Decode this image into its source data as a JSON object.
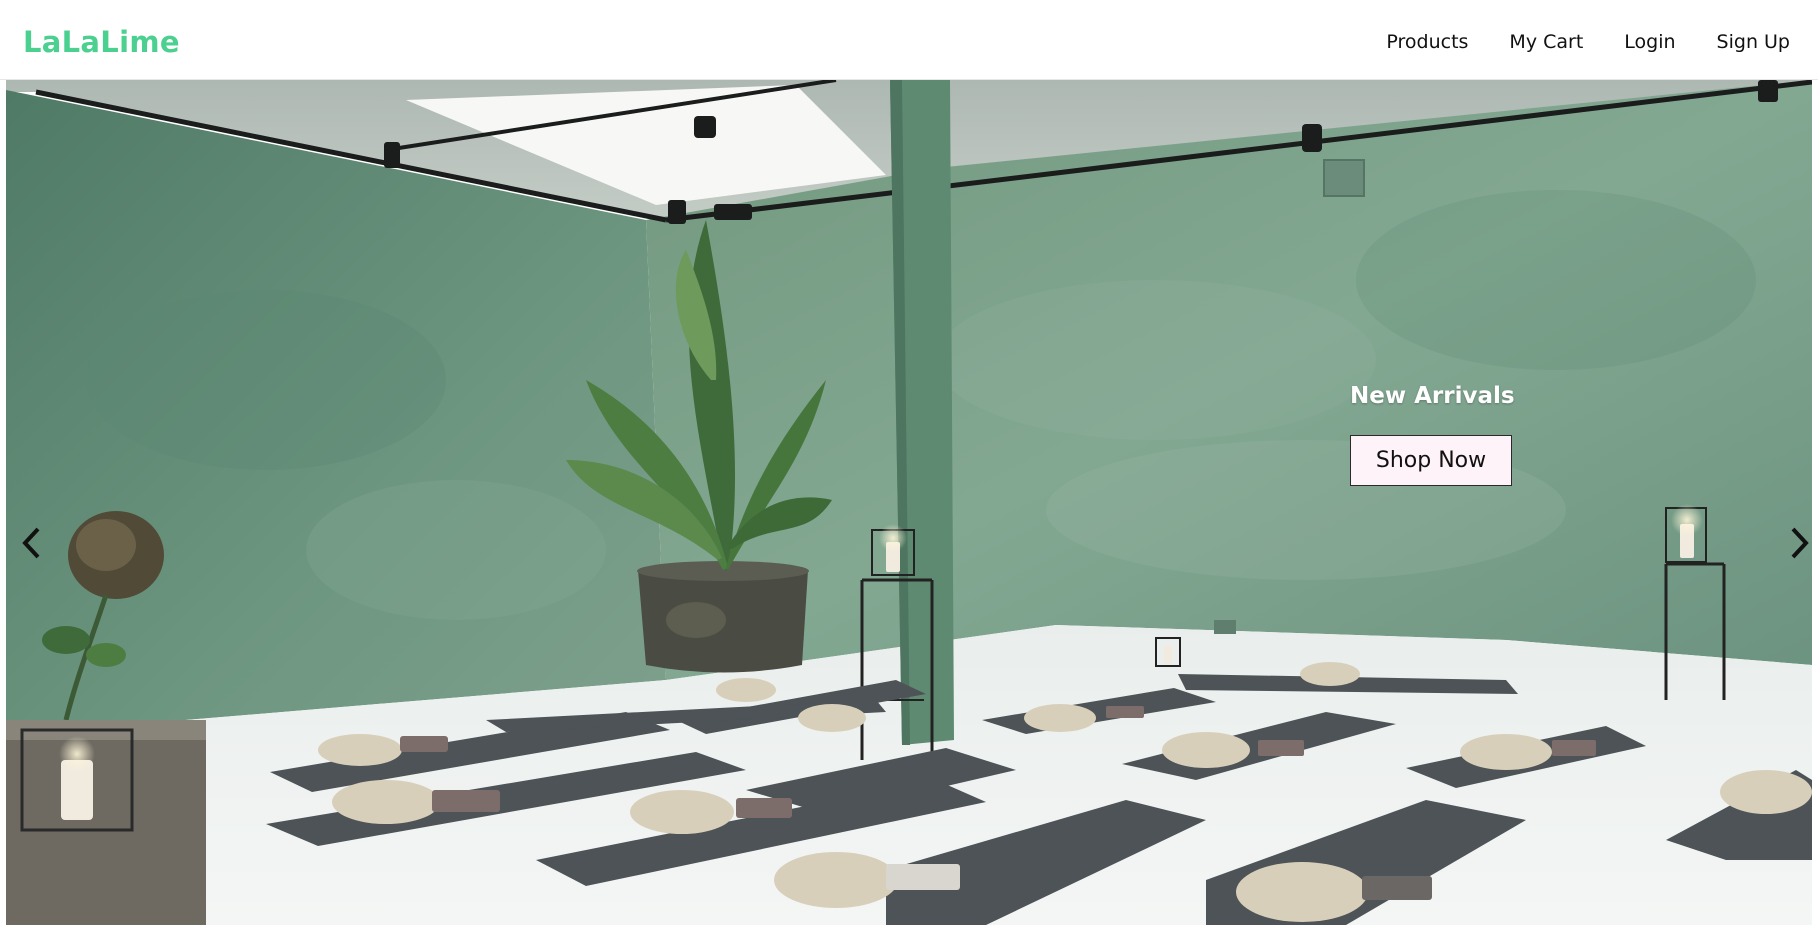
{
  "brand": {
    "name": "LaLaLime",
    "color": "#4cd08f"
  },
  "nav": {
    "items": [
      {
        "label": "Products"
      },
      {
        "label": "My Cart"
      },
      {
        "label": "Login"
      },
      {
        "label": "Sign Up"
      }
    ]
  },
  "hero": {
    "image": "yoga studio interior with green walls, mats and meditation cushions",
    "title": "New Arrivals",
    "cta_label": "Shop Now",
    "prev_icon": "chevron-left-icon",
    "next_icon": "chevron-right-icon"
  }
}
